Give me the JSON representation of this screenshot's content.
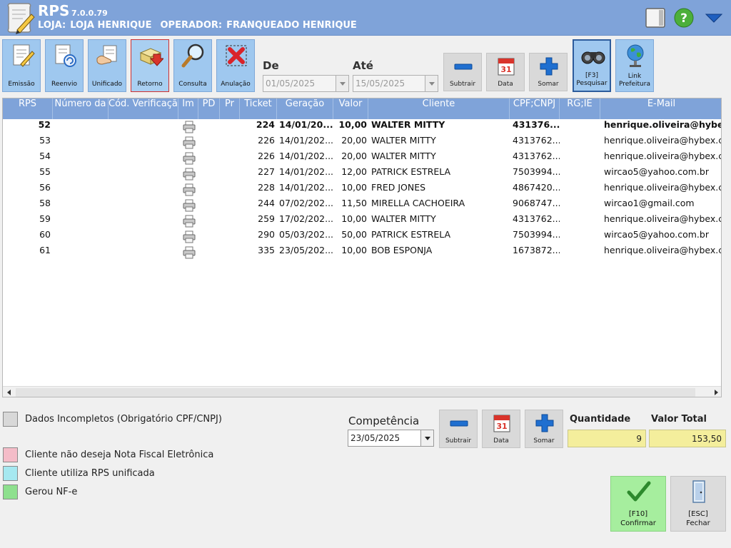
{
  "app": {
    "name": "RPS",
    "version": "7.0.0.79",
    "store_label": "LOJA:",
    "store_value": "LOJA HENRIQUE",
    "operator_label": "OPERADOR:",
    "operator_value": "FRANQUEADO HENRIQUE"
  },
  "toolbar": {
    "buttons": [
      {
        "label": "Emissão",
        "icon": "document-pen-icon"
      },
      {
        "label": "Reenvio",
        "icon": "document-resend-icon"
      },
      {
        "label": "Unificado",
        "icon": "document-hand-icon"
      },
      {
        "label": "Retorno",
        "icon": "return-box-icon"
      },
      {
        "label": "Consulta",
        "icon": "magnifier-icon"
      },
      {
        "label": "Anulação",
        "icon": "red-x-icon"
      }
    ],
    "date_from_label": "De",
    "date_from_value": "01/05/2025",
    "date_to_label": "Até",
    "date_to_value": "15/05/2025",
    "subtract_label": "Subtrair",
    "date_label": "Data",
    "add_label": "Somar",
    "search_label_1": "[F3]",
    "search_label_2": "Pesquisar",
    "link_label_1": "Link",
    "link_label_2": "Prefeitura"
  },
  "table": {
    "columns": [
      "RPS",
      "Número da",
      "Cód. Verificação",
      "Im",
      "PD",
      "Pr",
      "Ticket",
      "Geração",
      "Valor",
      "Cliente",
      "CPF;CNPJ",
      "RG;IE",
      "E-Mail"
    ],
    "rows": [
      {
        "rps": "52",
        "ticket": "224",
        "geracao": "14/01/20...",
        "valor": "10,00",
        "cliente": "WALTER MITTY",
        "cpf": "431376...",
        "email": "henrique.oliveira@hybex.",
        "bold": true
      },
      {
        "rps": "53",
        "ticket": "226",
        "geracao": "14/01/202...",
        "valor": "20,00",
        "cliente": "WALTER MITTY",
        "cpf": "4313762...",
        "email": "henrique.oliveira@hybex.co",
        "bold": false
      },
      {
        "rps": "54",
        "ticket": "226",
        "geracao": "14/01/202...",
        "valor": "20,00",
        "cliente": "WALTER MITTY",
        "cpf": "4313762...",
        "email": "henrique.oliveira@hybex.co",
        "bold": false
      },
      {
        "rps": "55",
        "ticket": "227",
        "geracao": "14/01/202...",
        "valor": "12,00",
        "cliente": "PATRICK ESTRELA",
        "cpf": "7503994...",
        "email": "wircao5@yahoo.com.br",
        "bold": false
      },
      {
        "rps": "56",
        "ticket": "228",
        "geracao": "14/01/202...",
        "valor": "10,00",
        "cliente": "FRED JONES",
        "cpf": "4867420...",
        "email": "henrique.oliveira@hybex.co",
        "bold": false
      },
      {
        "rps": "58",
        "ticket": "244",
        "geracao": "07/02/202...",
        "valor": "11,50",
        "cliente": "MIRELLA CACHOEIRA",
        "cpf": "9068747...",
        "email": "wircao1@gmail.com",
        "bold": false
      },
      {
        "rps": "59",
        "ticket": "259",
        "geracao": "17/02/202...",
        "valor": "10,00",
        "cliente": "WALTER MITTY",
        "cpf": "4313762...",
        "email": "henrique.oliveira@hybex.co",
        "bold": false
      },
      {
        "rps": "60",
        "ticket": "290",
        "geracao": "05/03/202...",
        "valor": "50,00",
        "cliente": "PATRICK ESTRELA",
        "cpf": "7503994...",
        "email": "wircao5@yahoo.com.br",
        "bold": false
      },
      {
        "rps": "61",
        "ticket": "335",
        "geracao": "23/05/202...",
        "valor": "10,00",
        "cliente": "BOB ESPONJA",
        "cpf": "1673872...",
        "email": "henrique.oliveira@hybex.co",
        "bold": false
      }
    ]
  },
  "legend": [
    {
      "label": "Dados Incompletos (Obrigatório CPF/CNPJ)",
      "color": "#d8d8d8"
    },
    {
      "label": "Cliente não deseja Nota Fiscal Eletrônica",
      "color": "#f4bcc8"
    },
    {
      "label": "Cliente utiliza RPS unificada",
      "color": "#a6e8f0"
    },
    {
      "label": "Gerou NF-e",
      "color": "#8ee08e"
    }
  ],
  "bottom": {
    "competencia_label": "Competência",
    "competencia_value": "23/05/2025",
    "subtract_label": "Subtrair",
    "date_label": "Data",
    "add_label": "Somar",
    "quantidade_label": "Quantidade",
    "quantidade_value": "9",
    "valor_total_label": "Valor Total",
    "valor_total_value": "153,50",
    "confirm_label_1": "[F10]",
    "confirm_label_2": "Confirmar",
    "close_label_1": "[ESC]",
    "close_label_2": "Fechar"
  },
  "colors": {
    "header_blue": "#7fa3d9",
    "toolbar_blue": "#9fc8ef",
    "confirm_green": "#a6ee9e",
    "total_yellow": "#f4ee9c"
  }
}
